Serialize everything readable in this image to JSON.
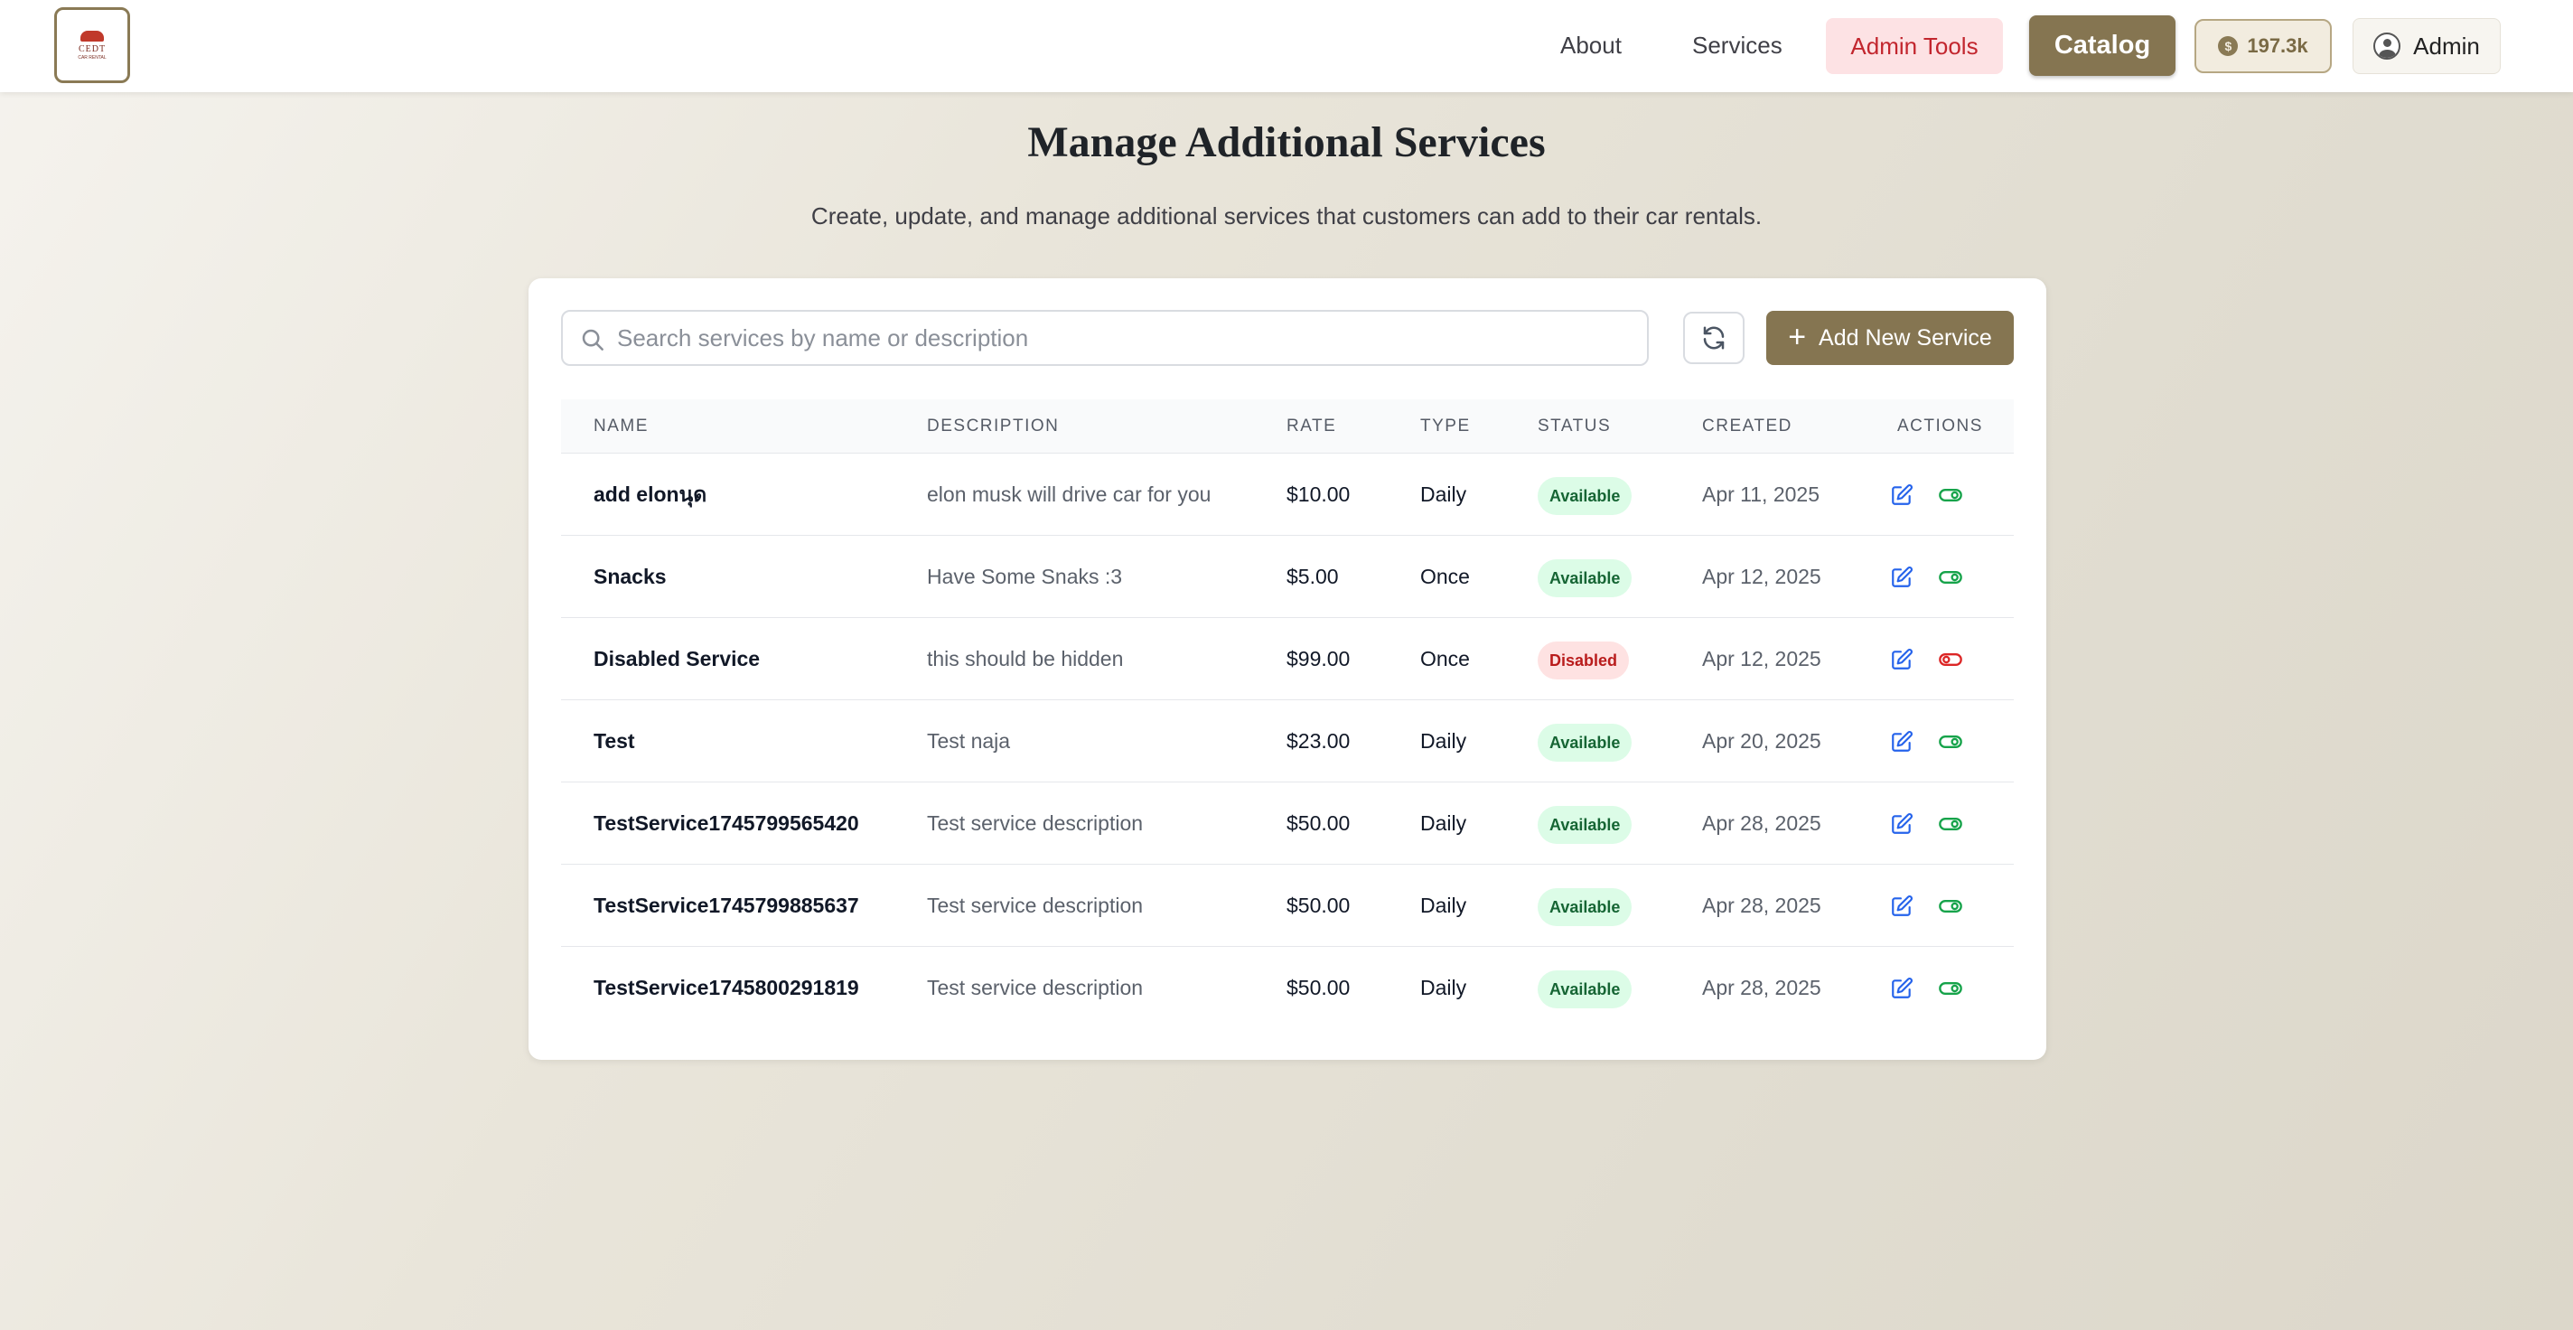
{
  "header": {
    "logo_text": "CEDT",
    "logo_subtext": "CAR RENTAL",
    "nav": {
      "about": "About",
      "services": "Services"
    },
    "admin_tools": "Admin Tools",
    "catalog": "Catalog",
    "credits": "197.3k",
    "user": "Admin"
  },
  "page": {
    "title": "Manage Additional Services",
    "subtitle": "Create, update, and manage additional services that customers can add to their car rentals."
  },
  "toolbar": {
    "search_placeholder": "Search services by name or description",
    "search_value": "",
    "add_label": "Add New Service"
  },
  "table": {
    "headers": [
      "NAME",
      "DESCRIPTION",
      "RATE",
      "TYPE",
      "STATUS",
      "CREATED",
      "ACTIONS"
    ],
    "rows": [
      {
        "name": "add elonนุด",
        "description": "elon musk will drive car for you",
        "rate": "$10.00",
        "type": "Daily",
        "status": "Available",
        "created": "Apr 11, 2025"
      },
      {
        "name": "Snacks",
        "description": "Have Some Snaks :3",
        "rate": "$5.00",
        "type": "Once",
        "status": "Available",
        "created": "Apr 12, 2025"
      },
      {
        "name": "Disabled Service",
        "description": "this should be hidden",
        "rate": "$99.00",
        "type": "Once",
        "status": "Disabled",
        "created": "Apr 12, 2025"
      },
      {
        "name": "Test",
        "description": "Test naja",
        "rate": "$23.00",
        "type": "Daily",
        "status": "Available",
        "created": "Apr 20, 2025"
      },
      {
        "name": "TestService1745799565420",
        "description": "Test service description",
        "rate": "$50.00",
        "type": "Daily",
        "status": "Available",
        "created": "Apr 28, 2025"
      },
      {
        "name": "TestService1745799885637",
        "description": "Test service description",
        "rate": "$50.00",
        "type": "Daily",
        "status": "Available",
        "created": "Apr 28, 2025"
      },
      {
        "name": "TestService1745800291819",
        "description": "Test service description",
        "rate": "$50.00",
        "type": "Daily",
        "status": "Available",
        "created": "Apr 28, 2025"
      }
    ]
  },
  "colors": {
    "accent": "#857551",
    "admin_tools_bg": "#fde2e4",
    "admin_tools_text": "#c2262e",
    "available_bg": "#dcfce7",
    "disabled_bg": "#fee2e2",
    "edit_icon": "#2563eb",
    "toggle_on": "#16a34a",
    "toggle_off": "#dc2626"
  },
  "icons": {
    "search": "search-icon",
    "refresh": "refresh-icon",
    "add": "plus-icon",
    "edit": "edit-icon",
    "toggle": "toggle-icon",
    "coin": "coin-icon",
    "user": "user-circle-icon"
  }
}
